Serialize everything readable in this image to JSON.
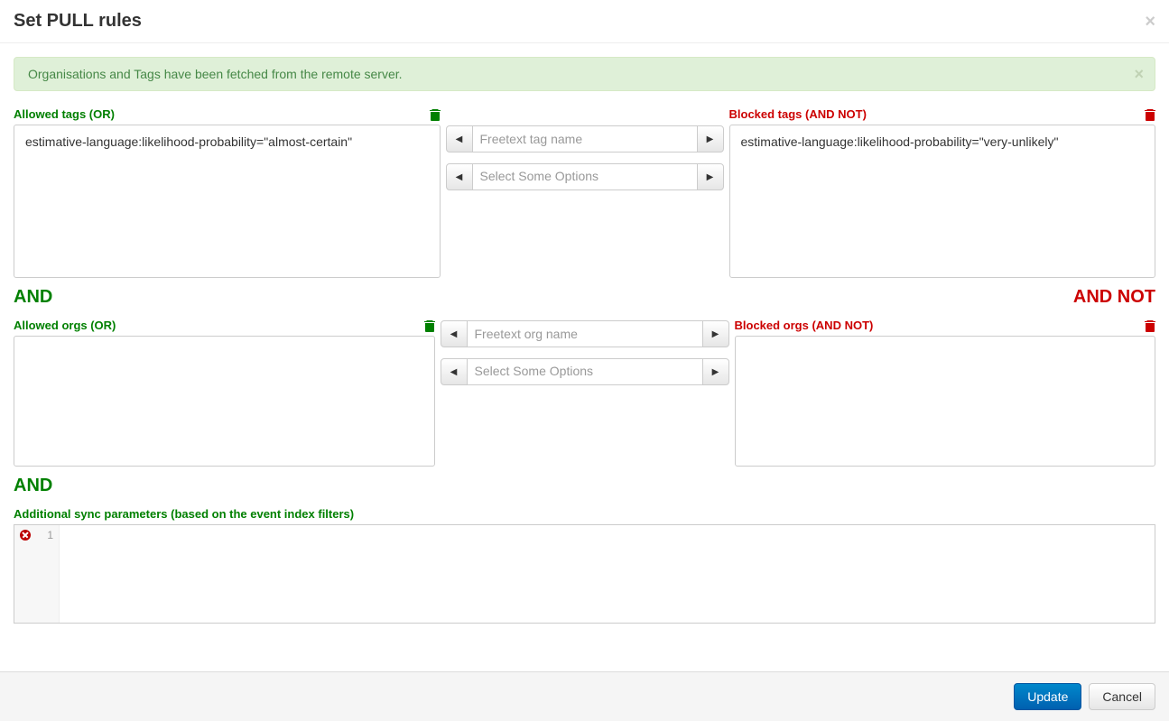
{
  "modal": {
    "title": "Set PULL rules",
    "close_glyph": "×"
  },
  "alert": {
    "message": "Organisations and Tags have been fetched from the remote server.",
    "close_glyph": "×"
  },
  "tags": {
    "allowed": {
      "label": "Allowed tags (OR)",
      "items": [
        "estimative-language:likelihood-probability=\"almost-certain\""
      ]
    },
    "blocked": {
      "label": "Blocked tags (AND NOT)",
      "items": [
        "estimative-language:likelihood-probability=\"very-unlikely\""
      ]
    },
    "freetext_placeholder": "Freetext tag name",
    "select_placeholder": "Select Some Options"
  },
  "operator_and": "AND",
  "operator_and_not": "AND NOT",
  "orgs": {
    "allowed": {
      "label": "Allowed orgs (OR)",
      "items": []
    },
    "blocked": {
      "label": "Blocked orgs (AND NOT)",
      "items": []
    },
    "freetext_placeholder": "Freetext org name",
    "select_placeholder": "Select Some Options"
  },
  "additional": {
    "label": "Additional sync parameters (based on the event index filters)",
    "line_number": "1"
  },
  "footer": {
    "update": "Update",
    "cancel": "Cancel"
  },
  "glyphs": {
    "triangle_left": "◀",
    "triangle_right": "▶"
  }
}
